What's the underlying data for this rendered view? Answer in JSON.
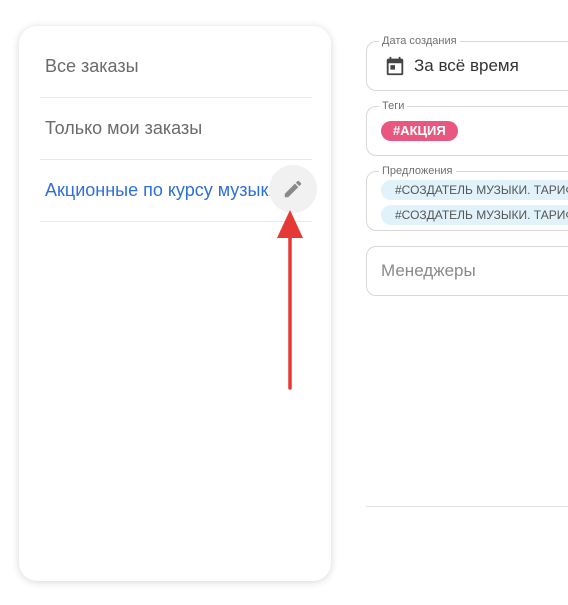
{
  "saved_filters": {
    "items": [
      {
        "label": "Все заказы",
        "active": false
      },
      {
        "label": "Только мои заказы",
        "active": false
      },
      {
        "label": "Акционные по курсу музыки",
        "active": true
      }
    ],
    "edit_icon": "pencil-icon"
  },
  "annotation": {
    "arrow_color": "#e53935",
    "icon": "arrow-up-icon"
  },
  "filters": {
    "date": {
      "legend": "Дата создания",
      "value": "За всё время",
      "icon": "calendar-icon"
    },
    "tags": {
      "legend": "Теги",
      "chips": [
        "#АКЦИЯ"
      ],
      "chip_color": "#e8577f"
    },
    "offers": {
      "legend": "Предложения",
      "chips": [
        "#СОЗДАТЕЛЬ МУЗЫКИ. ТАРИФ",
        "#СОЗДАТЕЛЬ МУЗЫКИ. ТАРИФ"
      ],
      "chip_color": "#e1f2fb"
    },
    "managers": {
      "placeholder": "Менеджеры"
    }
  },
  "colors": {
    "accent": "#2f6fd8",
    "muted_text": "#6b6b6b"
  }
}
